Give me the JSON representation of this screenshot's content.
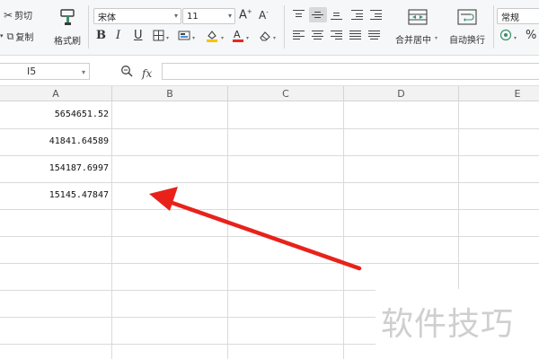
{
  "ribbon": {
    "clipboard": {
      "cut_label": "剪切",
      "copy_label": "复制",
      "format_painter_label": "格式刷"
    },
    "font": {
      "name": "宋体",
      "size": "11"
    },
    "alignment": {
      "merge_center_label": "合并居中",
      "wrap_text_label": "自动换行"
    },
    "number": {
      "format": "常规",
      "percent_symbol": "%"
    }
  },
  "formula_bar": {
    "cell_ref": "I5",
    "fx_label": "fx",
    "formula": ""
  },
  "grid": {
    "columns": [
      "A",
      "B",
      "C",
      "D",
      "E"
    ],
    "column_a_values": [
      "5654651.52",
      "41841.64589",
      "154187.6997",
      "15145.47847"
    ]
  },
  "overlay": {
    "watermark": "软件技巧",
    "arrow_color": "#e8221b"
  }
}
